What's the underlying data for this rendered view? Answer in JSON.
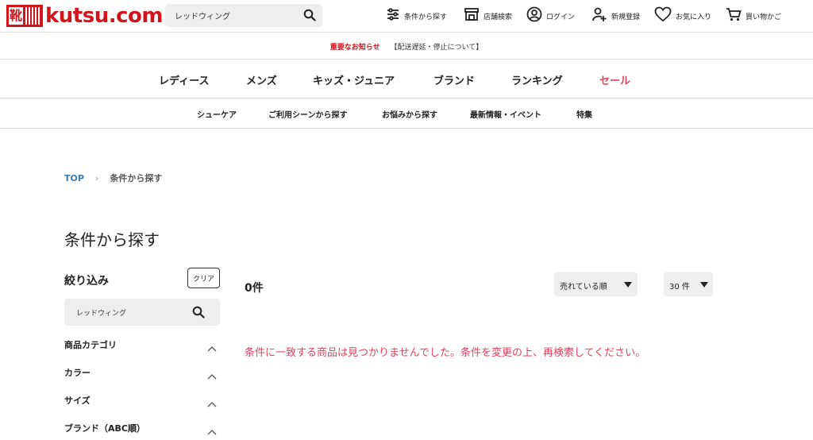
{
  "header": {
    "logo_kanji": "靴",
    "logo_text": "kutsu.com",
    "search": {
      "value": "レッドウィング",
      "placeholder": ""
    },
    "nav": [
      {
        "icon": "sliders-icon",
        "label": "条件から探す"
      },
      {
        "icon": "store-icon",
        "label": "店舗検索"
      },
      {
        "icon": "user-icon",
        "label": "ログイン"
      },
      {
        "icon": "user-plus-icon",
        "label": "新規登録"
      },
      {
        "icon": "heart-icon",
        "label": "お気に入り"
      },
      {
        "icon": "cart-icon",
        "label": "買い物かご"
      }
    ]
  },
  "notice": {
    "important": "重要なお知らせ",
    "info": "【配送遅延・停止について】"
  },
  "main_nav": [
    "レディース",
    "メンズ",
    "キッズ・ジュニア",
    "ブランド",
    "ランキング",
    "セール"
  ],
  "sub_nav": [
    "シューケア",
    "ご利用シーンから探す",
    "お悩みから探す",
    "最新情報・イベント",
    "特集"
  ],
  "breadcrumb": {
    "top": "TOP",
    "separator": "›",
    "current": "条件から探す"
  },
  "page_title": "条件から探す",
  "filter": {
    "title": "絞り込み",
    "clear": "クリア",
    "search_value": "レッドウィング",
    "facets": [
      "商品カテゴリ",
      "カラー",
      "サイズ",
      "ブランド（ABC順）"
    ]
  },
  "results": {
    "count": "0件",
    "sort": "売れている順",
    "per_page": "30 件",
    "message": "条件に一致する商品は見つかりませんでした。条件を変更の上、再検索してください。"
  },
  "colors": {
    "brand_red": "#d2151c",
    "sale_pink": "#e0445e",
    "link_blue": "#3a7bbd"
  }
}
